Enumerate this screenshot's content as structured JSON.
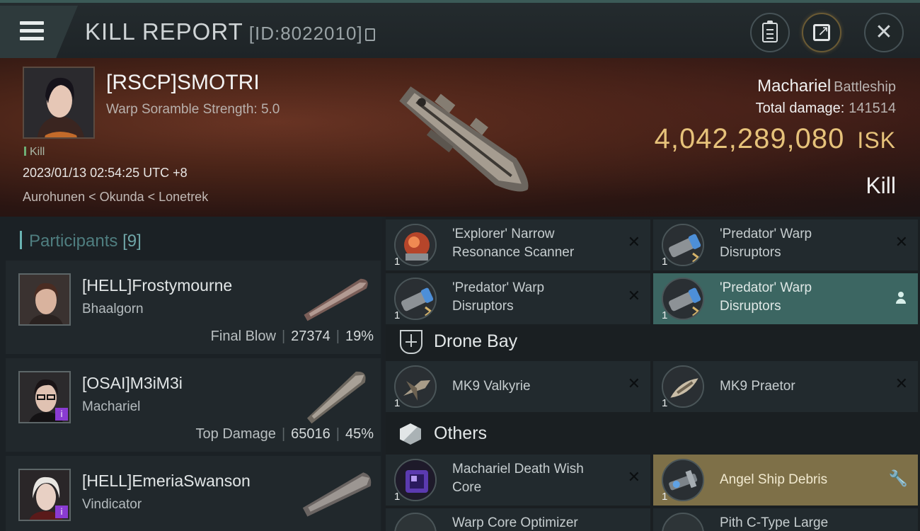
{
  "header": {
    "title": "KILL REPORT",
    "report_id": "[ID:8022010]",
    "icons": [
      "menu-icon",
      "copy-icon",
      "clipboard-icon",
      "share-icon",
      "close-icon"
    ]
  },
  "victim": {
    "name": "[RSCP]SMOTRI",
    "warp_scramble": "Warp Soramble Strength: 5.0",
    "tag": "Kill",
    "datetime": "2023/01/13 02:54:25 UTC +8",
    "location": "Aurohunen < Okunda < Lonetrek",
    "ship": "Machariel",
    "ship_class": "Battleship",
    "total_damage_label": "Total damage:",
    "total_damage": "141514",
    "isk_value": "4,042,289,080",
    "isk_unit": "ISK",
    "result": "Kill"
  },
  "participants": {
    "label": "Participants",
    "count": "[9]",
    "rows": [
      {
        "name": "[HELL]Frostymourne",
        "ship": "Bhaalgorn",
        "role": "Final Blow",
        "damage": "27374",
        "percent": "19%"
      },
      {
        "name": "[OSAI]M3iM3i",
        "ship": "Machariel",
        "role": "Top Damage",
        "damage": "65016",
        "percent": "45%"
      },
      {
        "name": "[HELL]EmeriaSwanson",
        "ship": "Vindicator",
        "role": "",
        "damage": "",
        "percent": ""
      }
    ]
  },
  "items": {
    "modules": [
      {
        "name_l1": "'Explorer' Narrow",
        "name_l2": "Resonance Scanner",
        "qty": "1",
        "icon": "scanner-icon"
      },
      {
        "name_l1": "'Predator' Warp",
        "name_l2": "Disruptors",
        "qty": "1",
        "icon": "warp-disruptor-icon"
      },
      {
        "name_l1": "'Predator' Warp",
        "name_l2": "Disruptors",
        "qty": "1",
        "icon": "warp-disruptor-icon"
      },
      {
        "name_l1": "'Predator' Warp",
        "name_l2": "Disruptors",
        "qty": "1",
        "icon": "warp-disruptor-icon"
      }
    ],
    "drone_bay": {
      "title": "Drone Bay",
      "entries": [
        {
          "name": "MK9  Valkyrie",
          "qty": "1"
        },
        {
          "name": "MK9  Praetor",
          "qty": "1"
        }
      ]
    },
    "others": {
      "title": "Others",
      "entries": [
        {
          "name_l1": "Machariel Death Wish",
          "name_l2": "Core",
          "qty": "1"
        },
        {
          "name_l1": "Angel Ship Debris",
          "name_l2": "",
          "qty": "1"
        },
        {
          "name_l1": "Warp Core Optimizer",
          "name_l2": "",
          "qty": ""
        },
        {
          "name_l1": "Pith C-Type Large",
          "name_l2": "",
          "qty": ""
        }
      ]
    }
  },
  "colors": {
    "accent_teal": "#3c6662",
    "accent_gold": "#e6c27a",
    "highlight_gold": "#7e7048"
  }
}
